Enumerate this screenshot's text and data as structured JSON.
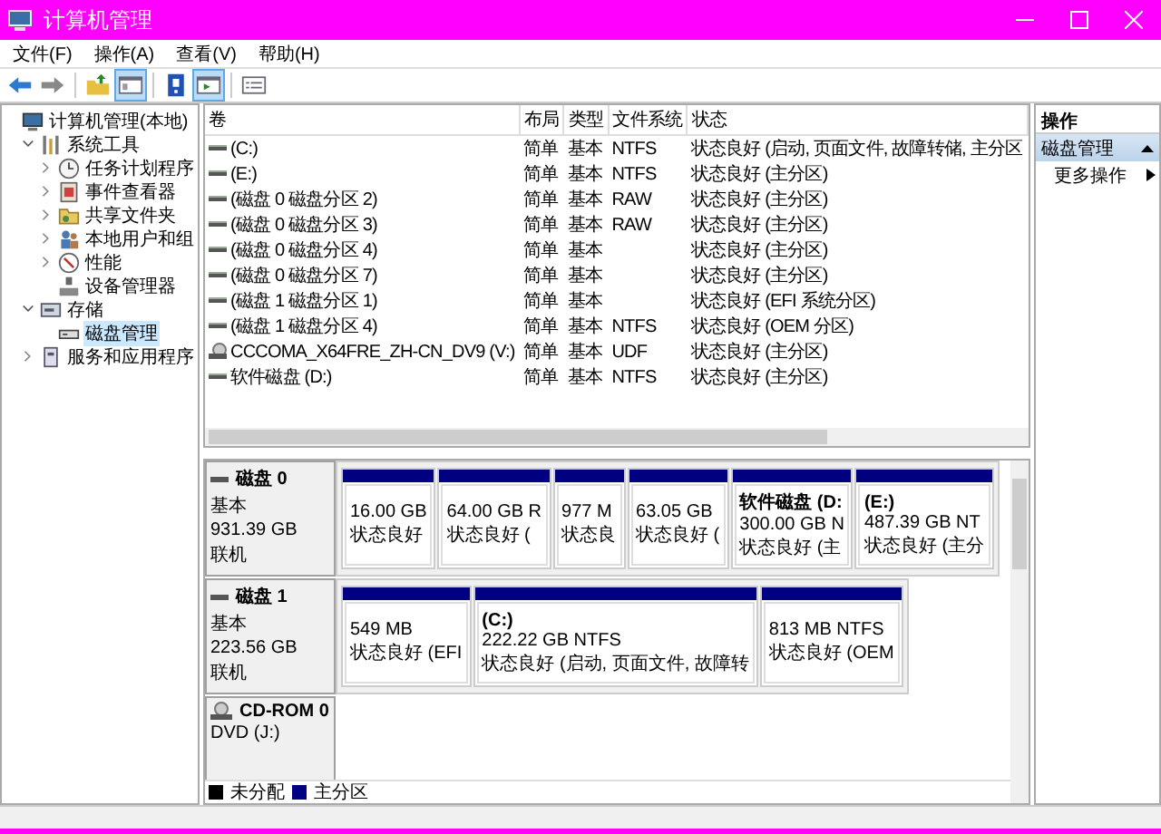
{
  "window": {
    "title": "计算机管理"
  },
  "menu": [
    "文件(F)",
    "操作(A)",
    "查看(V)",
    "帮助(H)"
  ],
  "toolbar": [
    {
      "kind": "back",
      "pressed": false
    },
    {
      "kind": "forward",
      "pressed": false
    },
    {
      "kind": "separator"
    },
    {
      "kind": "up",
      "pressed": false
    },
    {
      "kind": "tree",
      "pressed": true
    },
    {
      "kind": "separator"
    },
    {
      "kind": "help",
      "pressed": false
    },
    {
      "kind": "pane",
      "pressed": true
    },
    {
      "kind": "separator"
    },
    {
      "kind": "properties",
      "pressed": false
    }
  ],
  "tree": [
    {
      "label": "计算机管理(本地)",
      "kind": "computer",
      "selected": false,
      "children": [
        {
          "label": "系统工具",
          "kind": "tools",
          "selected": false,
          "expanded": true,
          "children": [
            {
              "label": "任务计划程序",
              "kind": "clock",
              "selected": false,
              "expanded": false
            },
            {
              "label": "事件查看器",
              "kind": "event",
              "selected": false,
              "expanded": false
            },
            {
              "label": "共享文件夹",
              "kind": "folder",
              "selected": false,
              "expanded": false
            },
            {
              "label": "本地用户和组",
              "kind": "users",
              "selected": false,
              "expanded": false
            },
            {
              "label": "性能",
              "kind": "performance",
              "selected": false,
              "expanded": false
            },
            {
              "label": "设备管理器",
              "kind": "device",
              "selected": false
            }
          ]
        },
        {
          "label": "存储",
          "kind": "storage",
          "selected": false,
          "expanded": true,
          "children": [
            {
              "label": "磁盘管理",
              "kind": "disk",
              "selected": true
            }
          ]
        },
        {
          "label": "服务和应用程序",
          "kind": "services",
          "selected": false,
          "expanded": false
        }
      ]
    }
  ],
  "table": {
    "columns": [
      "卷",
      "布局",
      "类型",
      "文件系统",
      "状态"
    ],
    "rows": [
      {
        "kind": "volume",
        "volume": "(C:)",
        "layout": "简单",
        "type": "基本",
        "file_system": "NTFS",
        "status": "状态良好 (启动, 页面文件, 故障转储, 主分区"
      },
      {
        "kind": "volume",
        "volume": "(E:)",
        "layout": "简单",
        "type": "基本",
        "file_system": "NTFS",
        "status": "状态良好 (主分区)"
      },
      {
        "kind": "volume",
        "volume": "(磁盘 0 磁盘分区 2)",
        "layout": "简单",
        "type": "基本",
        "file_system": "RAW",
        "status": "状态良好 (主分区)"
      },
      {
        "kind": "volume",
        "volume": "(磁盘 0 磁盘分区 3)",
        "layout": "简单",
        "type": "基本",
        "file_system": "RAW",
        "status": "状态良好 (主分区)"
      },
      {
        "kind": "volume",
        "volume": "(磁盘 0 磁盘分区 4)",
        "layout": "简单",
        "type": "基本",
        "status": "状态良好 (主分区)"
      },
      {
        "kind": "volume",
        "volume": "(磁盘 0 磁盘分区 7)",
        "layout": "简单",
        "type": "基本",
        "status": "状态良好 (主分区)"
      },
      {
        "kind": "volume",
        "volume": "(磁盘 1 磁盘分区 1)",
        "layout": "简单",
        "type": "基本",
        "status": "状态良好 (EFI 系统分区)"
      },
      {
        "kind": "volume",
        "volume": "(磁盘 1 磁盘分区 4)",
        "layout": "简单",
        "type": "基本",
        "file_system": "NTFS",
        "status": "状态良好 (OEM 分区)"
      },
      {
        "kind": "optical",
        "volume": "CCCOMA_X64FRE_ZH-CN_DV9 (V:)",
        "layout": "简单",
        "type": "基本",
        "file_system": "UDF",
        "status": "状态良好 (主分区)"
      },
      {
        "kind": "volume",
        "volume": "软件磁盘 (D:)",
        "layout": "简单",
        "type": "基本",
        "file_system": "NTFS",
        "status": "状态良好 (主分区)"
      }
    ]
  },
  "disks": [
    {
      "kind": "disk",
      "name": "磁盘 0",
      "type": "基本",
      "size": "931.39 GB",
      "state": "联机",
      "partitions": [
        {
          "size": "16.00 GB",
          "status": "状态良好"
        },
        {
          "size": "64.00 GB R",
          "status": "状态良好 ("
        },
        {
          "size": "977 M",
          "status": "状态良"
        },
        {
          "size": "63.05 GB",
          "status": "状态良好 ("
        },
        {
          "title": "软件磁盘  (D:",
          "size": "300.00 GB N",
          "status": "状态良好 (主"
        },
        {
          "title": "(E:)",
          "size": "487.39 GB NT",
          "status": "状态良好 (主分"
        }
      ]
    },
    {
      "kind": "disk",
      "name": "磁盘 1",
      "type": "基本",
      "size": "223.56 GB",
      "state": "联机",
      "partitions": [
        {
          "size": "549 MB",
          "status": "状态良好 (EFI"
        },
        {
          "title": "(C:)",
          "size": "222.22 GB NTFS",
          "status": "状态良好 (启动, 页面文件, 故障转"
        },
        {
          "size": "813 MB NTFS",
          "status": "状态良好 (OEM"
        }
      ]
    },
    {
      "kind": "cdrom",
      "name": "CD-ROM 0",
      "type": "DVD (J:)"
    }
  ],
  "legend": [
    {
      "label": "未分配",
      "color": "#000000"
    },
    {
      "label": "主分区",
      "color": "#000080"
    }
  ],
  "actions": {
    "title": "操作",
    "section": {
      "label": "磁盘管理",
      "expanded": true
    },
    "items": [
      "更多操作"
    ]
  }
}
